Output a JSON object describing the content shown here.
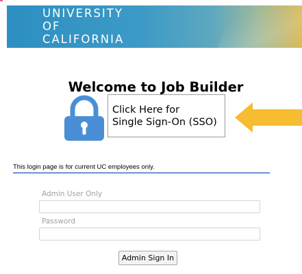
{
  "banner": {
    "logo_line1": "UNIVERSITY",
    "logo_line2": "OF",
    "logo_line3": "CALIFORNIA"
  },
  "page": {
    "title": "Welcome to Job Builder"
  },
  "sso": {
    "line1": "Click Here for",
    "line2": "Single Sign-On (SSO)",
    "lock_icon": "lock-icon",
    "arrow_icon": "arrow-left-icon",
    "lock_color": "#4a8fd6",
    "arrow_color": "#f5bd2f"
  },
  "login": {
    "notice": "This login page is for current UC employees only.",
    "user_label": "Admin User Only",
    "user_value": "",
    "password_label": "Password",
    "password_value": "",
    "signin_label": "Admin Sign In",
    "divider_color": "#6f8fd0"
  }
}
